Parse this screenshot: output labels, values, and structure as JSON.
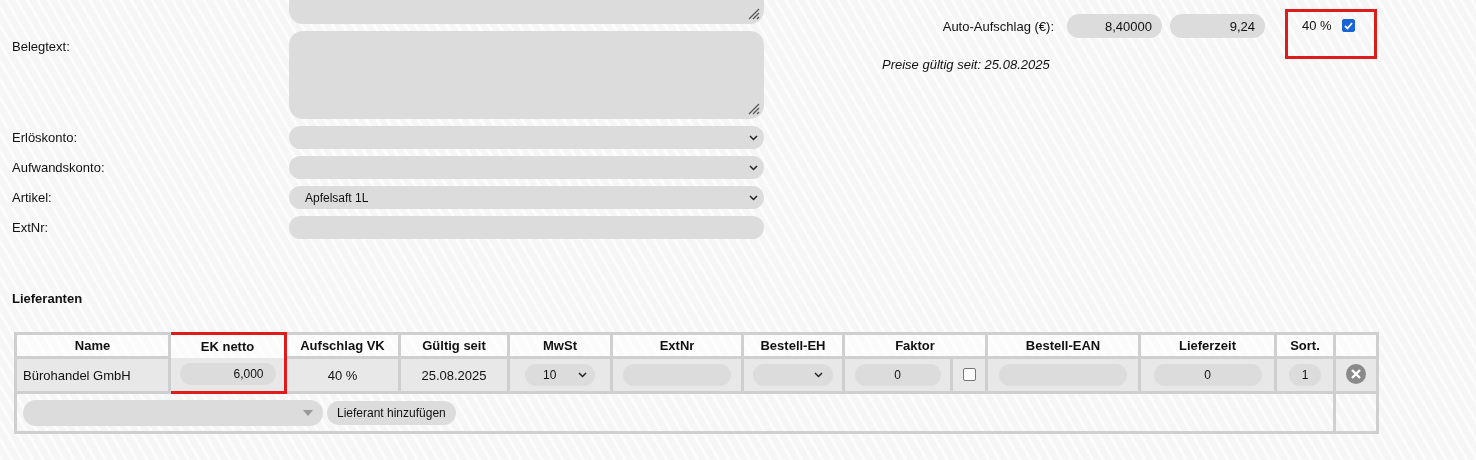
{
  "form_fields": [
    {
      "kind": "textarea_cut"
    },
    {
      "label": "Belegtext:",
      "kind": "textarea"
    },
    {
      "label": "Erlöskonto:",
      "kind": "select"
    },
    {
      "label": "Aufwandskonto:",
      "kind": "select"
    },
    {
      "label": "Artikel:",
      "kind": "select",
      "value": "Apfelsaft 1L"
    },
    {
      "label": "ExtNr:",
      "kind": "input"
    }
  ],
  "pricing": {
    "rows": [
      {
        "label": "Auto-Aufschlag (€):",
        "net": "8,40000",
        "gross": "9,24",
        "percent": "40 %",
        "checked": true,
        "highlighted": true
      }
    ],
    "valid_note": "Preise gültig seit: 25.08.2025"
  },
  "suppliers": {
    "title": "Lieferanten",
    "columns": [
      {
        "label": "Name",
        "highlighted": false
      },
      {
        "label": "EK netto",
        "highlighted": true
      },
      {
        "label": "Aufschlag VK",
        "highlighted": false
      },
      {
        "label": "Gültig seit",
        "highlighted": false
      },
      {
        "label": "MwSt",
        "highlighted": false
      },
      {
        "label": "ExtNr",
        "highlighted": false
      },
      {
        "label": "Bestell-EH",
        "highlighted": false
      },
      {
        "label": "Faktor",
        "highlighted": false
      },
      {
        "label": "Bestell-EAN",
        "highlighted": false
      },
      {
        "label": "Lieferzeit",
        "highlighted": false
      },
      {
        "label": "Sort.",
        "highlighted": false
      }
    ],
    "rows": [
      {
        "name": "Bürohandel GmbH",
        "ek_netto": "6,000",
        "aufschlag_vk": "40 %",
        "gueltig_seit": "25.08.2025",
        "mwst": "10",
        "faktor": "0",
        "faktor_checked": false,
        "lieferzeit": "0",
        "sort": "1"
      }
    ],
    "add_button": "Lieferant hinzufügen"
  }
}
